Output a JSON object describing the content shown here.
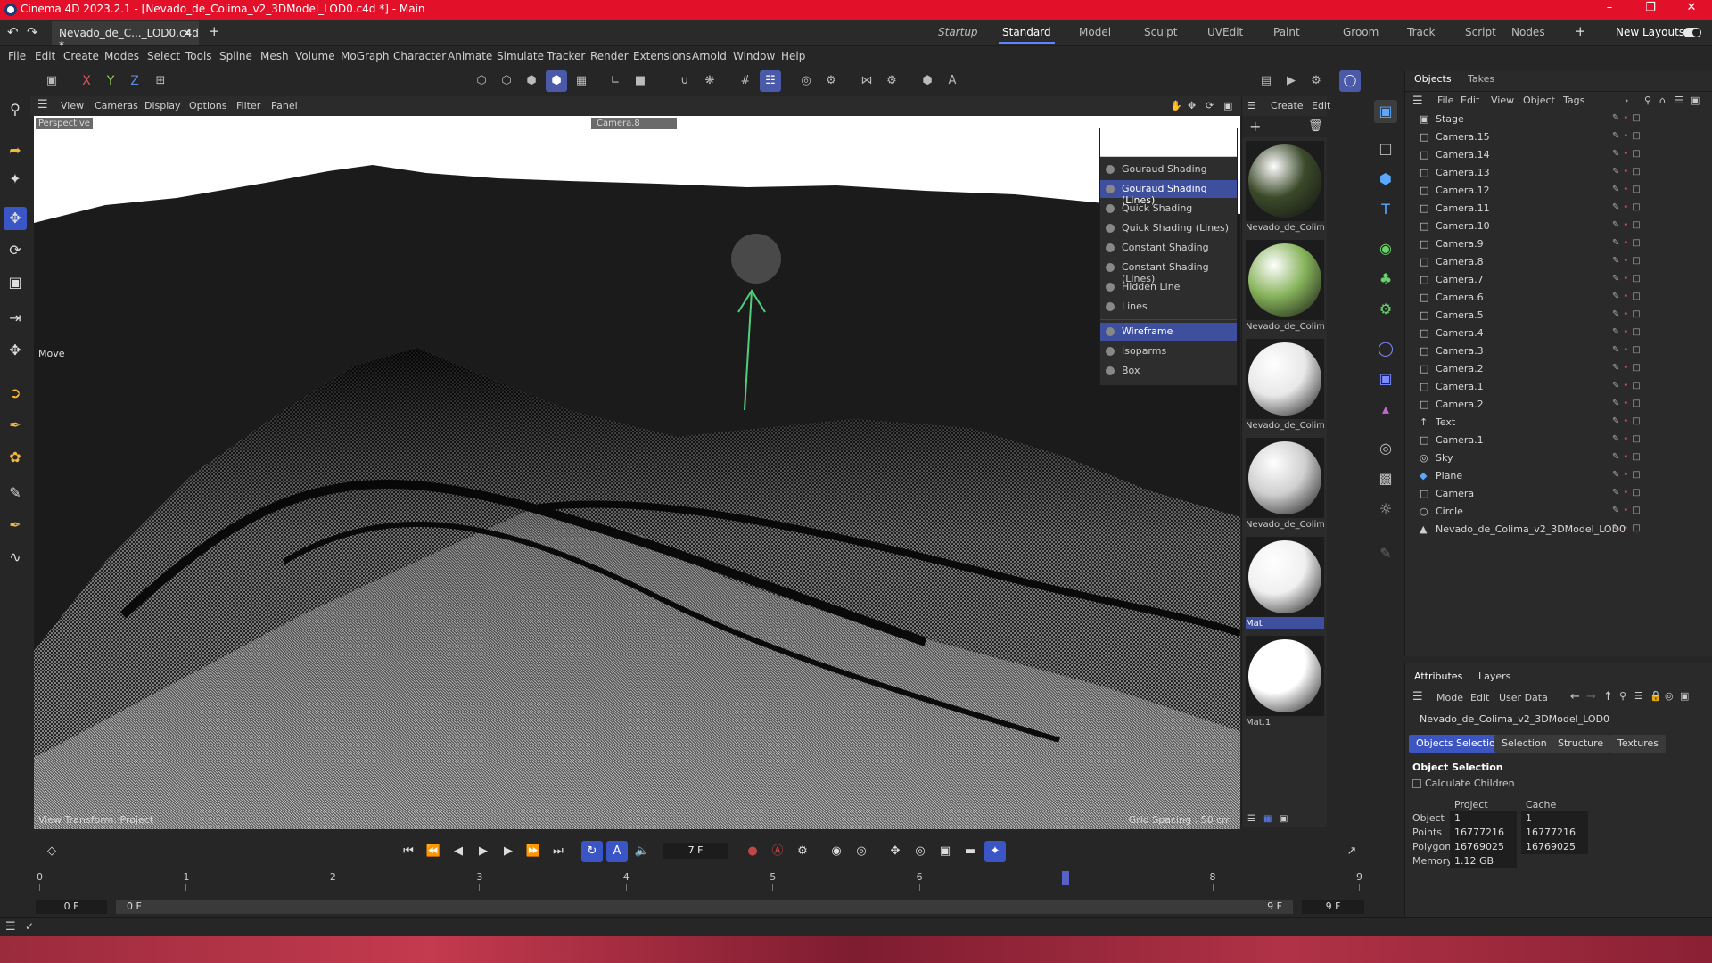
{
  "window": {
    "title": "Cinema 4D 2023.2.1 - [Nevado_de_Colima_v2_3DModel_LOD0.c4d *] - Main"
  },
  "doc_tab": {
    "label": "Nevado_de_C..._LOD0.c4d *"
  },
  "layouts": [
    "Startup",
    "Standard",
    "Model",
    "Sculpt",
    "UVEdit",
    "Paint",
    "Groom",
    "Track",
    "Script",
    "Nodes"
  ],
  "layouts_active": "Standard",
  "new_layouts_label": "New Layouts",
  "menu": [
    "File",
    "Edit",
    "Create",
    "Modes",
    "Select",
    "Tools",
    "Spline",
    "Mesh",
    "Volume",
    "MoGraph",
    "Character",
    "Animate",
    "Simulate",
    "Tracker",
    "Render",
    "Extensions",
    "Arnold",
    "Window",
    "Help"
  ],
  "axes": {
    "x": "X",
    "y": "Y",
    "z": "Z"
  },
  "viewport": {
    "menu": [
      "View",
      "Cameras",
      "Display",
      "Options",
      "Filter",
      "Panel"
    ],
    "label": "Perspective",
    "camera": "Camera.8",
    "tool_label": "Move",
    "footer_left": "View Transform: Project",
    "footer_right": "Grid Spacing : 50 cm"
  },
  "shading_menu": {
    "items": [
      "Gouraud Shading",
      "Gouraud Shading (Lines)",
      "Quick Shading",
      "Quick Shading (Lines)",
      "Constant Shading",
      "Constant Shading (Lines)",
      "Hidden Line",
      "Lines",
      "Wireframe",
      "Isoparms",
      "Box"
    ],
    "highlighted": [
      "Gouraud Shading (Lines)",
      "Wireframe"
    ]
  },
  "materials": {
    "menu": [
      "Create",
      "Edit"
    ],
    "items": [
      {
        "name": "Nevado_de_Colim",
        "color": "#3b4a2a"
      },
      {
        "name": "Nevado_de_Colim",
        "color": "#86b35a"
      },
      {
        "name": "Nevado_de_Colim",
        "color": "#e8e8e8"
      },
      {
        "name": "Nevado_de_Colim",
        "color": "#cfcfcf"
      },
      {
        "name": "Mat",
        "color": "#f0f0f0"
      },
      {
        "name": "Mat.1",
        "color": "#ffffff"
      }
    ]
  },
  "objects_panel": {
    "tabs": [
      "Objects",
      "Takes"
    ],
    "menu": [
      "File",
      "Edit",
      "View",
      "Object",
      "Tags"
    ],
    "rows": [
      {
        "name": "Stage",
        "icon": "stage-icon"
      },
      {
        "name": "Camera.15",
        "icon": "camera-icon"
      },
      {
        "name": "Camera.14",
        "icon": "camera-icon"
      },
      {
        "name": "Camera.13",
        "icon": "camera-icon"
      },
      {
        "name": "Camera.12",
        "icon": "camera-icon"
      },
      {
        "name": "Camera.11",
        "icon": "camera-icon"
      },
      {
        "name": "Camera.10",
        "icon": "camera-icon"
      },
      {
        "name": "Camera.9",
        "icon": "camera-icon"
      },
      {
        "name": "Camera.8",
        "icon": "camera-icon"
      },
      {
        "name": "Camera.7",
        "icon": "camera-icon"
      },
      {
        "name": "Camera.6",
        "icon": "camera-icon"
      },
      {
        "name": "Camera.5",
        "icon": "camera-icon"
      },
      {
        "name": "Camera.4",
        "icon": "camera-icon"
      },
      {
        "name": "Camera.3",
        "icon": "camera-icon"
      },
      {
        "name": "Camera.2",
        "icon": "camera-icon"
      },
      {
        "name": "Camera.1",
        "icon": "camera-icon"
      },
      {
        "name": "Camera.2",
        "icon": "camera-icon"
      },
      {
        "name": "Text",
        "icon": "text-icon"
      },
      {
        "name": "Camera.1",
        "icon": "camera-icon"
      },
      {
        "name": "Sky",
        "icon": "sky-icon"
      },
      {
        "name": "Plane",
        "icon": "plane-icon"
      },
      {
        "name": "Camera",
        "icon": "camera-icon"
      },
      {
        "name": "Circle",
        "icon": "circle-icon"
      },
      {
        "name": "Nevado_de_Colima_v2_3DModel_LOD0",
        "icon": "mesh-icon"
      }
    ]
  },
  "attributes": {
    "tabs": [
      "Attributes",
      "Layers"
    ],
    "menu": [
      "Mode",
      "Edit",
      "User Data"
    ],
    "object_name": "Nevado_de_Colima_v2_3DModel_LOD0",
    "buttons": [
      "Objects Selection",
      "Selection",
      "Structure",
      "Textures"
    ],
    "section": "Object Selection",
    "calculate_children": "Calculate Children",
    "col_project": "Project",
    "col_cache": "Cache",
    "stats": [
      {
        "label": "Object",
        "project": "1",
        "cache": "1"
      },
      {
        "label": "Points",
        "project": "16777216",
        "cache": "16777216"
      },
      {
        "label": "Polygons",
        "project": "16769025",
        "cache": "16769025"
      },
      {
        "label": "Memory",
        "project": "1.12 GB",
        "cache": ""
      }
    ]
  },
  "timeline": {
    "current_frame": "7 F",
    "start_frame": "0 F",
    "range_start": "0 F",
    "range_end": "9 F",
    "end_frame": "9 F",
    "ticks": [
      "0",
      "1",
      "2",
      "3",
      "4",
      "5",
      "6",
      "7",
      "8",
      "9"
    ],
    "playhead_frame": 7
  },
  "colors": {
    "titlebar": "#e3102a",
    "accent": "#3a56c6",
    "highlight": "#3e4f9e"
  }
}
